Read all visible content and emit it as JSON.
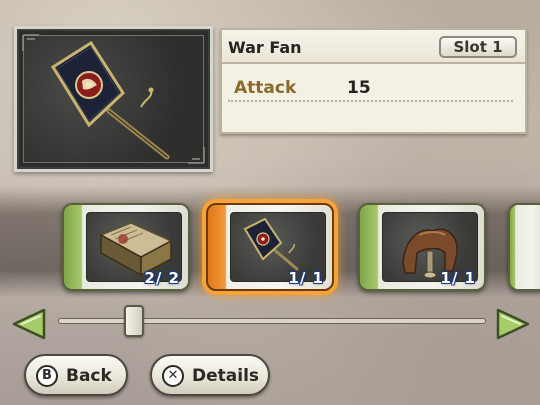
{
  "item": {
    "name": "War Fan",
    "slot_label": "Slot",
    "slot_number": "1",
    "stats": [
      {
        "label": "Attack",
        "value": "15"
      }
    ],
    "icon": "war-fan-icon"
  },
  "carousel": {
    "selected_index": 1,
    "items": [
      {
        "icon": "book-icon",
        "count": "2/ 2"
      },
      {
        "icon": "war-fan-icon",
        "count": "1/ 1"
      },
      {
        "icon": "saddle-icon",
        "count": "1/ 1"
      }
    ]
  },
  "scroll": {
    "position_fraction": 0.17
  },
  "buttons": {
    "back": {
      "glyph": "B",
      "label": "Back"
    },
    "details": {
      "glyph": "✕",
      "label": "Details"
    }
  },
  "colors": {
    "selected_accent": "#f19a3a",
    "card_accent": "#8fb556",
    "stat_label": "#8a6a28",
    "count_outline": "#1c3a78",
    "arrow_fill": "#9fc763"
  }
}
